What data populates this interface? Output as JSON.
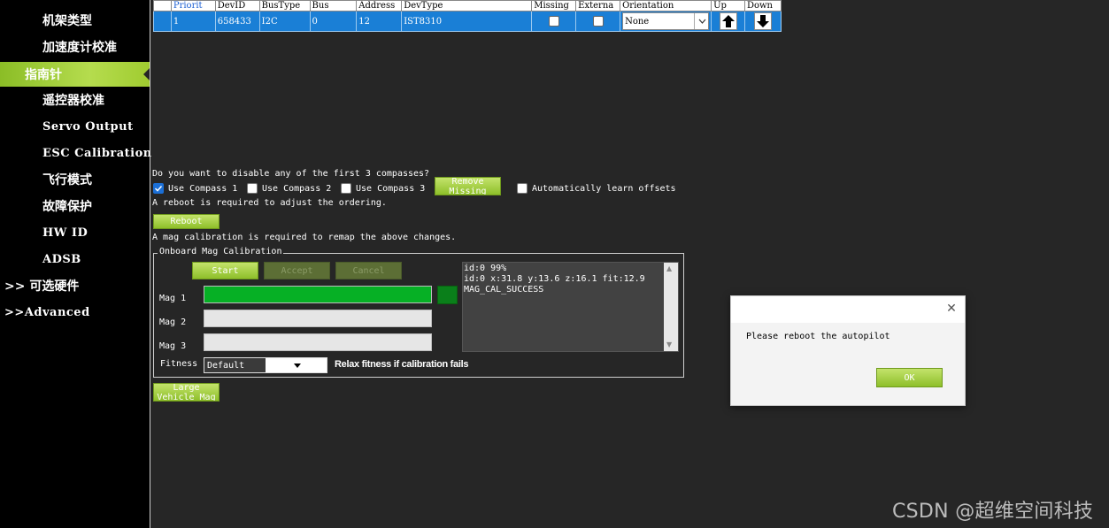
{
  "sidebar": {
    "items": [
      {
        "label": "机架类型"
      },
      {
        "label": "加速度计校准"
      },
      {
        "label": "指南针"
      },
      {
        "label": "遥控器校准"
      },
      {
        "label": "Servo Output"
      },
      {
        "label": "ESC Calibration"
      },
      {
        "label": "飞行模式"
      },
      {
        "label": "故障保护"
      },
      {
        "label": "HW ID"
      },
      {
        "label": "ADSB"
      },
      {
        "label": ">> 可选硬件"
      },
      {
        "label": ">>Advanced"
      }
    ]
  },
  "table": {
    "columns": [
      "Priorit",
      "DevID",
      "BusType",
      "Bus",
      "Address",
      "DevType",
      "Missing",
      "Externa",
      "Orientation",
      "Up",
      "Down"
    ],
    "rows": [
      {
        "priority": "1",
        "devid": "658433",
        "bustype": "I2C",
        "bus": "0",
        "address": "12",
        "devtype": "IST8310",
        "missing": false,
        "external": false,
        "orientation": "None"
      }
    ],
    "icons": {
      "up": "up-arrow-icon",
      "down": "down-arrow-icon",
      "dropdown": "chevron-down-icon"
    }
  },
  "compass": {
    "disable_question": "Do you want to disable any of the first 3 compasses?",
    "use1": "Use Compass 1",
    "use2": "Use Compass 2",
    "use3": "Use Compass 3",
    "use1_checked": true,
    "use2_checked": false,
    "use3_checked": false,
    "remove_missing": "Remove Missing",
    "auto_learn": "Automatically learn offsets",
    "auto_learn_checked": false,
    "reboot_note": "A reboot is required to adjust the ordering.",
    "reboot_button": "Reboot",
    "mag_cal_note": "A mag calibration is required to remap the above changes."
  },
  "onboard": {
    "title": "Onboard Mag Calibration",
    "start": "Start",
    "accept": "Accept",
    "cancel": "Cancel",
    "mag1": "Mag 1",
    "mag2": "Mag 2",
    "mag3": "Mag 3",
    "mag1_progress": 1.0,
    "mag2_progress": 0.0,
    "mag3_progress": 0.0,
    "fitness_label": "Fitness",
    "fitness_value": "Default",
    "relax_label": "Relax fitness if calibration fails",
    "log": {
      "line1": "id:0 99%",
      "line2": "id:0 x:31.8 y:13.6 z:16.1 fit:12.9",
      "line3": "MAG_CAL_SUCCESS"
    },
    "large_vehicle": "Large Vehicle Mag"
  },
  "dialog": {
    "message": "Please reboot the autopilot",
    "ok": "OK"
  },
  "watermark": "CSDN @超维空间科技",
  "colors": {
    "accent_green": "#8ebf2a",
    "selection_blue": "#1a7fd6",
    "progress_green": "#06b025"
  }
}
